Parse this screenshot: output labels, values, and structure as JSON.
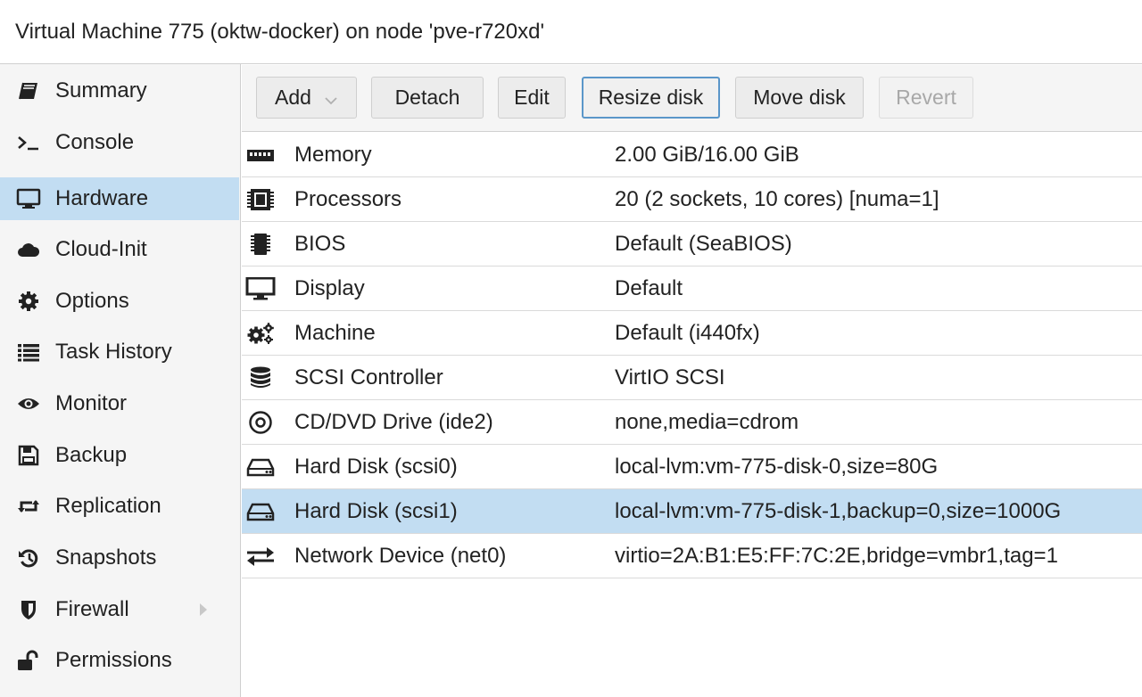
{
  "window": {
    "title": "Virtual Machine 775 (oktw-docker) on node 'pve-r720xd'"
  },
  "sidebar": {
    "items": [
      {
        "label": "Summary",
        "icon": "book-icon"
      },
      {
        "label": "Console",
        "icon": "terminal-icon"
      },
      {
        "label": "Hardware",
        "icon": "monitor-icon",
        "selected": true
      },
      {
        "label": "Cloud-Init",
        "icon": "cloud-icon"
      },
      {
        "label": "Options",
        "icon": "gear-icon"
      },
      {
        "label": "Task History",
        "icon": "list-icon"
      },
      {
        "label": "Monitor",
        "icon": "eye-icon"
      },
      {
        "label": "Backup",
        "icon": "floppy-icon"
      },
      {
        "label": "Replication",
        "icon": "retweet-icon"
      },
      {
        "label": "Snapshots",
        "icon": "history-icon"
      },
      {
        "label": "Firewall",
        "icon": "shield-icon",
        "expandable": true
      },
      {
        "label": "Permissions",
        "icon": "unlock-icon"
      }
    ]
  },
  "toolbar": {
    "add_label": "Add",
    "detach_label": "Detach",
    "edit_label": "Edit",
    "resize_label": "Resize disk",
    "move_label": "Move disk",
    "revert_label": "Revert"
  },
  "hardware": {
    "rows": [
      {
        "name": "Memory",
        "value": "2.00 GiB/16.00 GiB",
        "icon": "memory-icon"
      },
      {
        "name": "Processors",
        "value": "20 (2 sockets, 10 cores) [numa=1]",
        "icon": "cpu-icon"
      },
      {
        "name": "BIOS",
        "value": "Default (SeaBIOS)",
        "icon": "bios-chip-icon"
      },
      {
        "name": "Display",
        "value": "Default",
        "icon": "display-icon"
      },
      {
        "name": "Machine",
        "value": "Default (i440fx)",
        "icon": "cogs-icon"
      },
      {
        "name": "SCSI Controller",
        "value": "VirtIO SCSI",
        "icon": "database-icon"
      },
      {
        "name": "CD/DVD Drive (ide2)",
        "value": "none,media=cdrom",
        "icon": "cdrom-icon"
      },
      {
        "name": "Hard Disk (scsi0)",
        "value": "local-lvm:vm-775-disk-0,size=80G",
        "icon": "hdd-icon"
      },
      {
        "name": "Hard Disk (scsi1)",
        "value": "local-lvm:vm-775-disk-1,backup=0,size=1000G",
        "icon": "hdd-icon",
        "selected": true
      },
      {
        "name": "Network Device (net0)",
        "value": "virtio=2A:B1:E5:FF:7C:2E,bridge=vmbr1,tag=1",
        "icon": "exchange-icon"
      }
    ]
  },
  "colors": {
    "selection": "#c2ddf2",
    "focus_border": "#5a96c9",
    "panel_bg": "#f5f5f5"
  }
}
